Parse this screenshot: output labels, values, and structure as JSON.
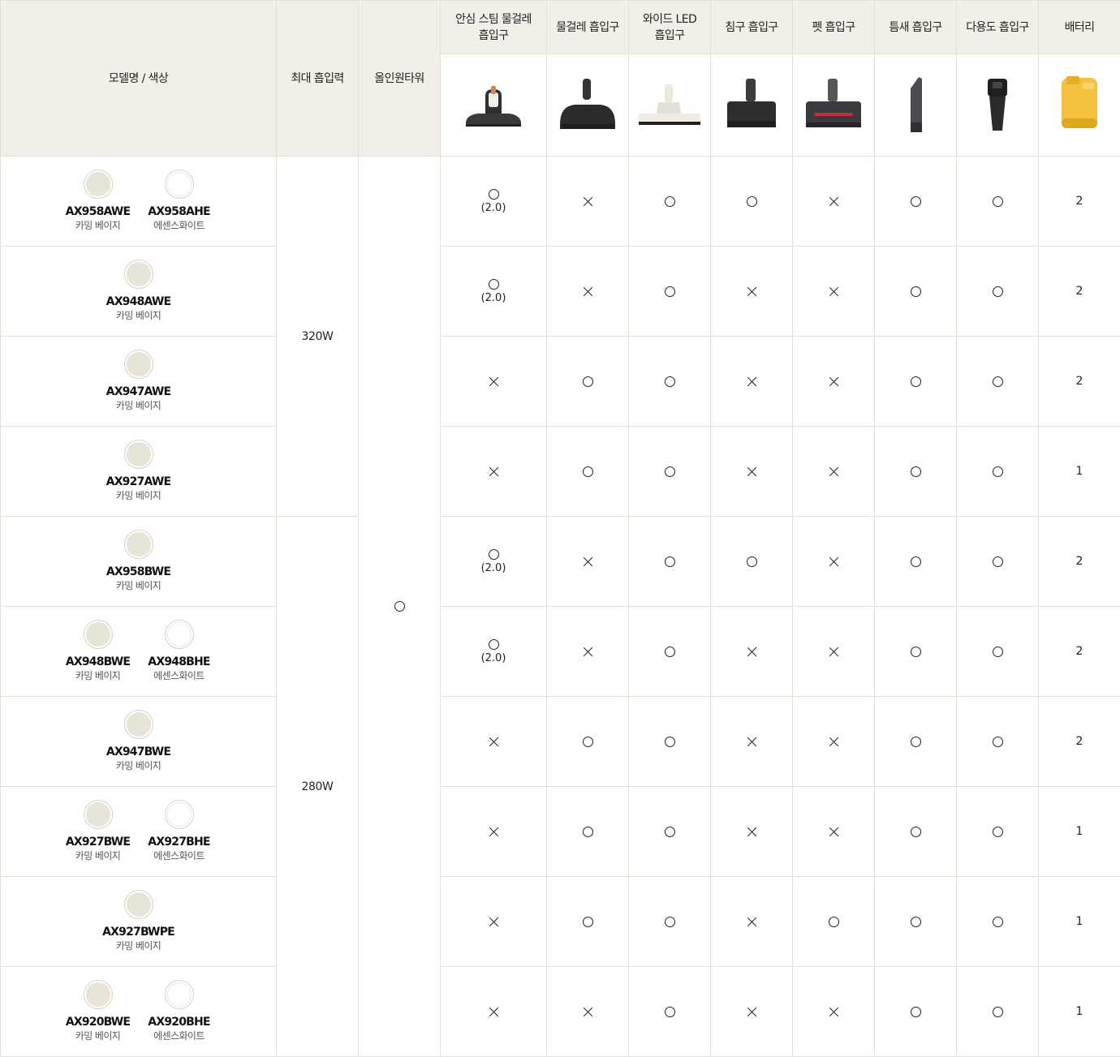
{
  "headers": {
    "model": "모델명 / 색상",
    "power": "최대 흡입력",
    "allinone": "올인원타워",
    "nozzles": [
      "안심 스팀 물걸레 흡입구",
      "물걸레 흡입구",
      "와이드 LED 흡입구",
      "침구 흡입구",
      "펫 흡입구",
      "틈새 흡입구",
      "다용도 흡입구"
    ],
    "battery": "배터리"
  },
  "product_images": [
    "steam-mop-nozzle-icon",
    "mop-nozzle-icon",
    "wide-led-nozzle-icon",
    "bedding-nozzle-icon",
    "pet-nozzle-icon",
    "crevice-nozzle-icon",
    "multi-purpose-nozzle-icon",
    "battery-icon"
  ],
  "power_groups": [
    "320W",
    "280W"
  ],
  "allinone_value": "○",
  "colors": {
    "beige": "#e9e4d8",
    "white": "#ffffff",
    "header_bg": "#f3efe8"
  },
  "rows": [
    {
      "models": [
        {
          "name": "AX958AWE",
          "color": "카밍 베이지"
        },
        {
          "name": "AX958AHE",
          "color": "에센스화이트"
        }
      ],
      "marks": [
        "O",
        "X",
        "O",
        "O",
        "X",
        "O",
        "O"
      ],
      "steam_sub": "(2.0)",
      "battery": "2"
    },
    {
      "models": [
        {
          "name": "AX948AWE",
          "color": "카밍 베이지"
        }
      ],
      "marks": [
        "O",
        "X",
        "O",
        "X",
        "X",
        "O",
        "O"
      ],
      "steam_sub": "(2.0)",
      "battery": "2"
    },
    {
      "models": [
        {
          "name": "AX947AWE",
          "color": "카밍 베이지"
        }
      ],
      "marks": [
        "X",
        "O",
        "O",
        "X",
        "X",
        "O",
        "O"
      ],
      "steam_sub": "",
      "battery": "2"
    },
    {
      "models": [
        {
          "name": "AX927AWE",
          "color": "카밍 베이지"
        }
      ],
      "marks": [
        "X",
        "O",
        "O",
        "X",
        "X",
        "O",
        "O"
      ],
      "steam_sub": "",
      "battery": "1"
    },
    {
      "models": [
        {
          "name": "AX958BWE",
          "color": "카밍 베이지"
        }
      ],
      "marks": [
        "O",
        "X",
        "O",
        "O",
        "X",
        "O",
        "O"
      ],
      "steam_sub": "(2.0)",
      "battery": "2"
    },
    {
      "models": [
        {
          "name": "AX948BWE",
          "color": "카밍 베이지"
        },
        {
          "name": "AX948BHE",
          "color": "에센스화이트"
        }
      ],
      "marks": [
        "O",
        "X",
        "O",
        "X",
        "X",
        "O",
        "O"
      ],
      "steam_sub": "(2.0)",
      "battery": "2"
    },
    {
      "models": [
        {
          "name": "AX947BWE",
          "color": "카밍 베이지"
        }
      ],
      "marks": [
        "X",
        "O",
        "O",
        "X",
        "X",
        "O",
        "O"
      ],
      "steam_sub": "",
      "battery": "2"
    },
    {
      "models": [
        {
          "name": "AX927BWE",
          "color": "카밍 베이지"
        },
        {
          "name": "AX927BHE",
          "color": "에센스화이트"
        }
      ],
      "marks": [
        "X",
        "O",
        "O",
        "X",
        "X",
        "O",
        "O"
      ],
      "steam_sub": "",
      "battery": "1"
    },
    {
      "models": [
        {
          "name": "AX927BWPE",
          "color": "카밍 베이지"
        }
      ],
      "marks": [
        "X",
        "O",
        "O",
        "X",
        "O",
        "O",
        "O"
      ],
      "steam_sub": "",
      "battery": "1"
    },
    {
      "models": [
        {
          "name": "AX920BWE",
          "color": "카밍 베이지"
        },
        {
          "name": "AX920BHE",
          "color": "에센스화이트"
        }
      ],
      "marks": [
        "X",
        "X",
        "O",
        "X",
        "X",
        "O",
        "O"
      ],
      "steam_sub": "",
      "battery": "1"
    }
  ]
}
